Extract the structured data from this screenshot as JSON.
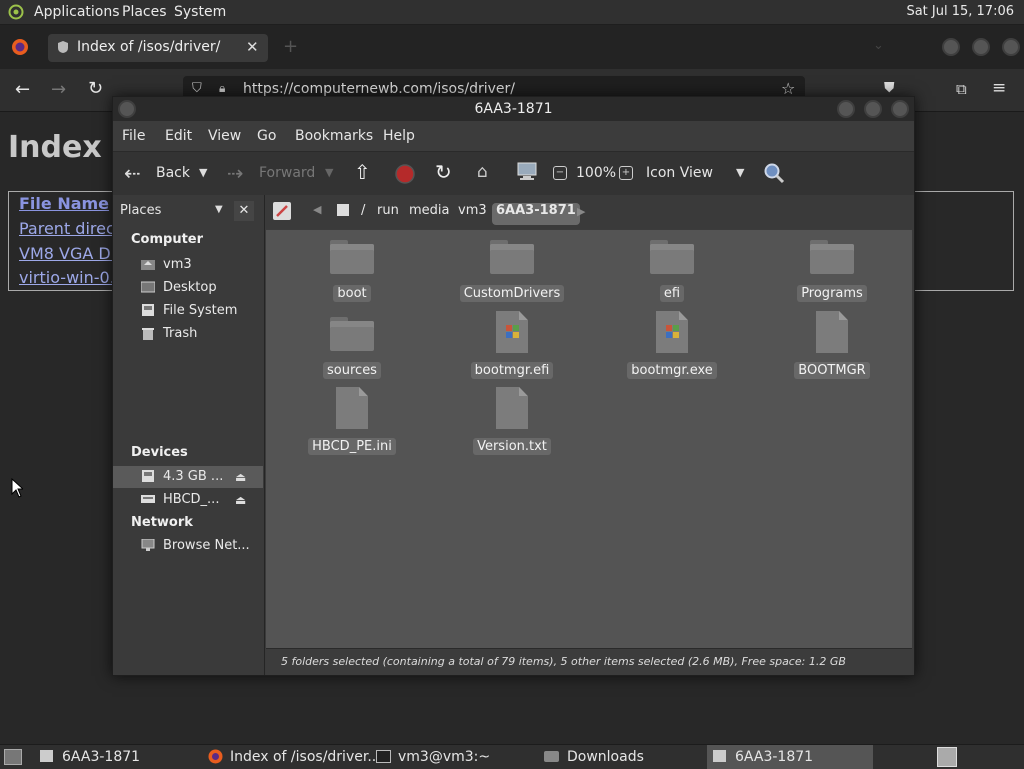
{
  "top_panel": {
    "menus": [
      "Applications",
      "Places",
      "System"
    ],
    "clock": "Sat Jul 15, 17:06"
  },
  "firefox": {
    "tab_title": "Index of /isos/driver/",
    "url": "https://computernewb.com/isos/driver/",
    "page": {
      "heading": "Index o",
      "column_header": "File Name",
      "rows": [
        "Parent directo",
        "VM8 VGA Dr",
        "virtio-win-0.1"
      ]
    }
  },
  "file_manager": {
    "title": "6AA3-1871",
    "menu": [
      "File",
      "Edit",
      "View",
      "Go",
      "Bookmarks",
      "Help"
    ],
    "toolbar": {
      "back": "Back",
      "forward": "Forward",
      "zoom": "100%",
      "view_mode": "Icon View"
    },
    "sidebar": {
      "dropdown": "Places",
      "sections": [
        {
          "heading": "Computer",
          "items": [
            {
              "label": "vm3",
              "icon": "home-folder-icon"
            },
            {
              "label": "Desktop",
              "icon": "desktop-icon"
            },
            {
              "label": "File System",
              "icon": "drive-icon"
            },
            {
              "label": "Trash",
              "icon": "trash-icon"
            }
          ]
        },
        {
          "heading": "Devices",
          "items": [
            {
              "label": "4.3 GB ...",
              "icon": "drive-icon",
              "eject": true,
              "selected": true
            },
            {
              "label": "HBCD_...",
              "icon": "drive-icon",
              "eject": true
            }
          ]
        },
        {
          "heading": "Network",
          "items": [
            {
              "label": "Browse Net...",
              "icon": "network-icon"
            }
          ]
        }
      ]
    },
    "pathbar": [
      "/",
      "run",
      "media",
      "vm3",
      "6AA3-1871"
    ],
    "files": [
      {
        "name": "boot",
        "type": "folder"
      },
      {
        "name": "CustomDrivers",
        "type": "folder"
      },
      {
        "name": "efi",
        "type": "folder"
      },
      {
        "name": "Programs",
        "type": "folder"
      },
      {
        "name": "sources",
        "type": "folder"
      },
      {
        "name": "bootmgr.efi",
        "type": "exe"
      },
      {
        "name": "bootmgr.exe",
        "type": "exe"
      },
      {
        "name": "BOOTMGR",
        "type": "file"
      },
      {
        "name": "HBCD_PE.ini",
        "type": "file"
      },
      {
        "name": "Version.txt",
        "type": "file"
      }
    ],
    "status": "5 folders selected (containing a total of 79 items), 5 other items selected (2.6 MB), Free space: 1.2 GB"
  },
  "taskbar": {
    "tasks": [
      {
        "label": "6AA3-1871",
        "icon": "drive-icon"
      },
      {
        "label": "Index of /isos/driver...",
        "icon": "firefox-icon"
      },
      {
        "label": "vm3@vm3:~",
        "icon": "terminal-icon"
      },
      {
        "label": "Downloads",
        "icon": "folder-icon"
      },
      {
        "label": "6AA3-1871",
        "icon": "drive-icon",
        "active": true
      }
    ]
  },
  "colors": {
    "panel_bg": "#303030",
    "window_bg": "#3b3b3b",
    "content_bg": "#545454",
    "link": "#9da8e8",
    "stop_red": "#b52a2a"
  }
}
